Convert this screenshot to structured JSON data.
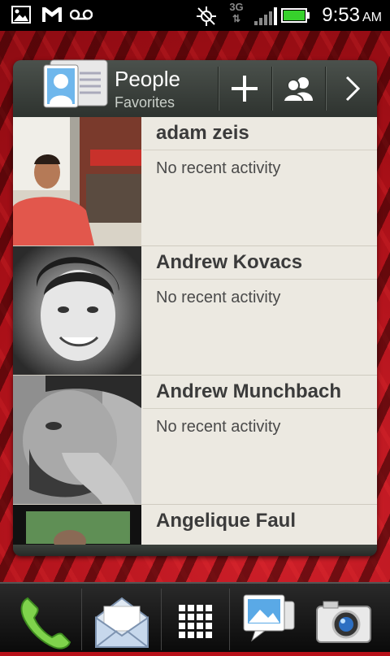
{
  "status_bar": {
    "time": "9:53",
    "ampm": "AM",
    "network": "3G",
    "icons": [
      "gallery-icon",
      "gmail-icon",
      "voicemail-icon",
      "gps-icon",
      "network-3g-icon",
      "signal-icon",
      "battery-icon"
    ]
  },
  "widget": {
    "title": "People",
    "subtitle": "Favorites",
    "buttons": [
      "add-icon",
      "groups-icon",
      "chevron-right-icon"
    ]
  },
  "contacts": [
    {
      "name": "adam zeis",
      "activity": "No recent activity"
    },
    {
      "name": "Andrew Kovacs",
      "activity": "No recent activity"
    },
    {
      "name": "Andrew Munchbach",
      "activity": "No recent activity"
    },
    {
      "name": "Angelique Faul",
      "activity": ""
    }
  ],
  "dock": {
    "items": [
      "phone-icon",
      "mail-icon",
      "app-drawer-icon",
      "messages-icon",
      "camera-icon"
    ]
  },
  "colors": {
    "wallpaper": "#b8121a",
    "widget_frame": "#3a3f3b",
    "list_bg": "#ece9e1"
  }
}
